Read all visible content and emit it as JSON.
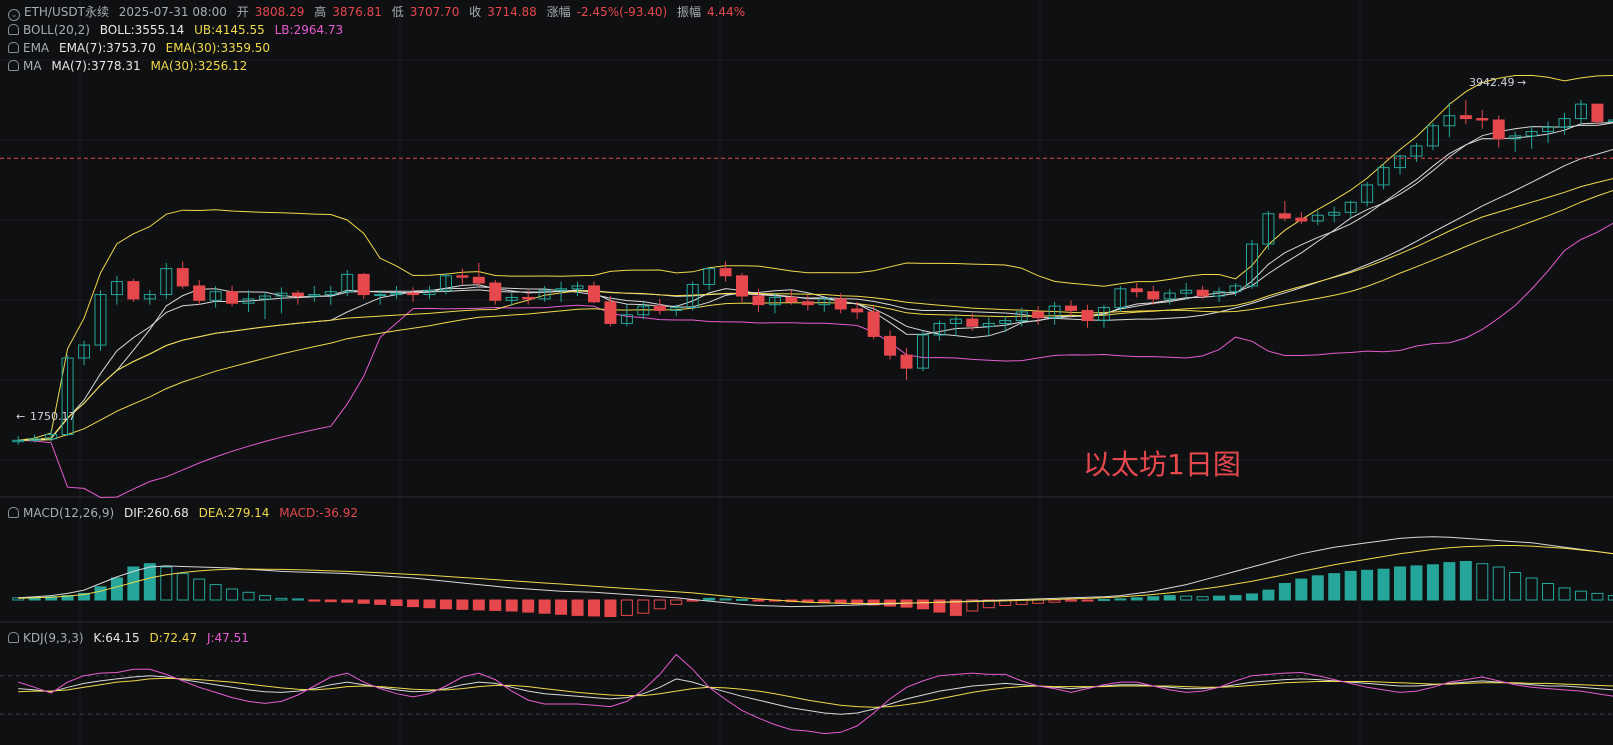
{
  "header": {
    "symbol": "ETH/USDT永续",
    "date": "2025-07-31 08:00",
    "open_label": "开",
    "open": "3808.29",
    "high_label": "高",
    "high": "3876.81",
    "low_label": "低",
    "low": "3707.70",
    "close_label": "收",
    "close": "3714.88",
    "change_label": "涨幅",
    "change": "-2.45%(-93.40)",
    "amp_label": "振幅",
    "amp": "4.44%"
  },
  "boll": {
    "name": "BOLL(20,2)",
    "boll": "BOLL:3555.14",
    "ub": "UB:4145.55",
    "lb": "LB:2964.73"
  },
  "ema": {
    "name": "EMA",
    "ema7": "EMA(7):3753.70",
    "ema30": "EMA(30):3359.50"
  },
  "ma": {
    "name": "MA",
    "ma7": "MA(7):3778.31",
    "ma30": "MA(30):3256.12"
  },
  "macd": {
    "name": "MACD(12,26,9)",
    "dif": "DIF:260.68",
    "dea": "DEA:279.14",
    "macd": "MACD:-36.92"
  },
  "kdj": {
    "name": "KDJ(9,3,3)",
    "k": "K:64.15",
    "d": "D:72.47",
    "j": "J:47.51"
  },
  "annotations": {
    "high_marker": "3942.49",
    "low_marker": "1750.17",
    "watermark": "以太坊1日图"
  },
  "colors": {
    "up": "#26a69a",
    "down": "#e5484d",
    "boll_mid": "#d9d9d9",
    "boll_band": "#f0d94b",
    "lower_band": "#e85bd1",
    "ema7": "#d9d9d9",
    "ema30": "#f0d94b",
    "ma7": "#d9d9d9",
    "ma30": "#f0d94b",
    "dif": "#d9d9d9",
    "dea": "#f0d94b",
    "k": "#d9d9d9",
    "d": "#f0d94b",
    "j": "#e85bd1"
  },
  "chart_data": {
    "type": "candlestick",
    "ylim": [
      1450,
      4500
    ],
    "current_price": 3714.88,
    "candles": [
      [
        1750,
        1790,
        1730,
        1760
      ],
      [
        1760,
        1800,
        1745,
        1770
      ],
      [
        1770,
        1830,
        1750,
        1800
      ],
      [
        1800,
        2350,
        1790,
        2330
      ],
      [
        2330,
        2450,
        2280,
        2420
      ],
      [
        2420,
        2800,
        2380,
        2770
      ],
      [
        2770,
        2900,
        2700,
        2860
      ],
      [
        2860,
        2880,
        2720,
        2740
      ],
      [
        2740,
        2800,
        2700,
        2770
      ],
      [
        2770,
        2990,
        2740,
        2950
      ],
      [
        2950,
        3000,
        2810,
        2830
      ],
      [
        2830,
        2870,
        2700,
        2730
      ],
      [
        2730,
        2830,
        2680,
        2790
      ],
      [
        2790,
        2830,
        2690,
        2710
      ],
      [
        2710,
        2800,
        2650,
        2740
      ],
      [
        2740,
        2790,
        2600,
        2760
      ],
      [
        2760,
        2820,
        2640,
        2780
      ],
      [
        2780,
        2800,
        2700,
        2760
      ],
      [
        2760,
        2830,
        2720,
        2770
      ],
      [
        2770,
        2830,
        2700,
        2790
      ],
      [
        2790,
        2940,
        2760,
        2910
      ],
      [
        2910,
        2920,
        2740,
        2770
      ],
      [
        2770,
        2800,
        2700,
        2770
      ],
      [
        2770,
        2830,
        2740,
        2780
      ],
      [
        2780,
        2820,
        2720,
        2770
      ],
      [
        2770,
        2830,
        2740,
        2800
      ],
      [
        2800,
        2920,
        2770,
        2900
      ],
      [
        2900,
        2950,
        2840,
        2890
      ],
      [
        2890,
        2990,
        2830,
        2850
      ],
      [
        2850,
        2870,
        2700,
        2730
      ],
      [
        2730,
        2780,
        2690,
        2750
      ],
      [
        2750,
        2800,
        2700,
        2740
      ],
      [
        2740,
        2830,
        2720,
        2800
      ],
      [
        2800,
        2860,
        2720,
        2810
      ],
      [
        2810,
        2860,
        2760,
        2830
      ],
      [
        2830,
        2860,
        2710,
        2720
      ],
      [
        2720,
        2760,
        2550,
        2570
      ],
      [
        2570,
        2700,
        2550,
        2630
      ],
      [
        2630,
        2720,
        2600,
        2690
      ],
      [
        2690,
        2740,
        2630,
        2660
      ],
      [
        2660,
        2700,
        2620,
        2680
      ],
      [
        2680,
        2860,
        2660,
        2840
      ],
      [
        2840,
        2960,
        2800,
        2950
      ],
      [
        2950,
        3000,
        2860,
        2900
      ],
      [
        2900,
        2920,
        2720,
        2760
      ],
      [
        2760,
        2810,
        2650,
        2700
      ],
      [
        2700,
        2780,
        2640,
        2750
      ],
      [
        2750,
        2800,
        2700,
        2720
      ],
      [
        2720,
        2770,
        2660,
        2700
      ],
      [
        2700,
        2760,
        2650,
        2740
      ],
      [
        2740,
        2780,
        2640,
        2670
      ],
      [
        2670,
        2720,
        2600,
        2650
      ],
      [
        2650,
        2690,
        2460,
        2480
      ],
      [
        2480,
        2520,
        2320,
        2350
      ],
      [
        2350,
        2400,
        2180,
        2260
      ],
      [
        2260,
        2520,
        2240,
        2490
      ],
      [
        2490,
        2590,
        2450,
        2570
      ],
      [
        2570,
        2620,
        2480,
        2600
      ],
      [
        2600,
        2640,
        2520,
        2550
      ],
      [
        2550,
        2610,
        2480,
        2570
      ],
      [
        2570,
        2620,
        2510,
        2590
      ],
      [
        2590,
        2680,
        2550,
        2650
      ],
      [
        2650,
        2690,
        2560,
        2610
      ],
      [
        2610,
        2720,
        2560,
        2690
      ],
      [
        2690,
        2730,
        2620,
        2660
      ],
      [
        2660,
        2700,
        2540,
        2590
      ],
      [
        2590,
        2700,
        2540,
        2680
      ],
      [
        2680,
        2830,
        2650,
        2810
      ],
      [
        2810,
        2850,
        2750,
        2790
      ],
      [
        2790,
        2830,
        2700,
        2740
      ],
      [
        2740,
        2810,
        2700,
        2780
      ],
      [
        2780,
        2850,
        2740,
        2800
      ],
      [
        2800,
        2830,
        2740,
        2760
      ],
      [
        2760,
        2820,
        2720,
        2790
      ],
      [
        2790,
        2850,
        2760,
        2830
      ],
      [
        2830,
        3150,
        2810,
        3120
      ],
      [
        3120,
        3350,
        3080,
        3330
      ],
      [
        3330,
        3420,
        3280,
        3300
      ],
      [
        3300,
        3340,
        3260,
        3280
      ],
      [
        3280,
        3350,
        3250,
        3320
      ],
      [
        3320,
        3380,
        3270,
        3340
      ],
      [
        3340,
        3420,
        3300,
        3410
      ],
      [
        3410,
        3550,
        3380,
        3530
      ],
      [
        3530,
        3680,
        3500,
        3650
      ],
      [
        3650,
        3740,
        3600,
        3730
      ],
      [
        3730,
        3820,
        3690,
        3800
      ],
      [
        3800,
        3960,
        3770,
        3940
      ],
      [
        3940,
        4100,
        3860,
        4010
      ],
      [
        4010,
        4120,
        3950,
        3990
      ],
      [
        3990,
        4050,
        3920,
        3980
      ],
      [
        3980,
        4010,
        3790,
        3850
      ],
      [
        3850,
        3900,
        3760,
        3870
      ],
      [
        3870,
        3940,
        3780,
        3900
      ],
      [
        3900,
        3970,
        3820,
        3930
      ],
      [
        3930,
        4030,
        3880,
        3990
      ],
      [
        3990,
        4120,
        3950,
        4090
      ],
      [
        4090,
        4060,
        3940,
        3970
      ],
      [
        3970,
        4010,
        3900,
        3980
      ],
      [
        3980,
        4000,
        3890,
        3990
      ],
      [
        3990,
        4030,
        3910,
        4000
      ],
      [
        3808,
        3876,
        3707,
        3714
      ]
    ],
    "macd_hist": [
      20,
      25,
      30,
      40,
      60,
      120,
      200,
      300,
      330,
      300,
      240,
      190,
      140,
      100,
      70,
      40,
      15,
      10,
      -10,
      -15,
      -20,
      -30,
      -40,
      -50,
      -60,
      -70,
      -80,
      -85,
      -90,
      -95,
      -100,
      -110,
      -120,
      -130,
      -140,
      -145,
      -150,
      -140,
      -120,
      -80,
      -40,
      -10,
      15,
      10,
      5,
      -5,
      -10,
      -15,
      -20,
      -25,
      -30,
      -35,
      -45,
      -55,
      -65,
      -80,
      -110,
      -140,
      -100,
      -70,
      -50,
      -40,
      -30,
      -20,
      -10,
      -5,
      5,
      10,
      20,
      30,
      40,
      35,
      30,
      35,
      40,
      55,
      90,
      150,
      190,
      220,
      240,
      260,
      270,
      280,
      300,
      310,
      320,
      340,
      350,
      330,
      300,
      250,
      200,
      150,
      110,
      80,
      60,
      40,
      20,
      -37
    ],
    "dif": [
      20,
      30,
      40,
      60,
      90,
      150,
      210,
      260,
      300,
      310,
      305,
      300,
      295,
      290,
      280,
      270,
      260,
      255,
      250,
      245,
      240,
      230,
      220,
      210,
      200,
      185,
      170,
      155,
      140,
      125,
      110,
      100,
      90,
      80,
      75,
      70,
      60,
      50,
      40,
      30,
      20,
      5,
      -10,
      -25,
      -40,
      -50,
      -55,
      -60,
      -58,
      -55,
      -50,
      -45,
      -40,
      -35,
      -30,
      -25,
      -20,
      -15,
      -10,
      -5,
      0,
      5,
      10,
      15,
      20,
      25,
      30,
      40,
      60,
      80,
      110,
      140,
      180,
      220,
      260,
      300,
      340,
      380,
      420,
      450,
      480,
      500,
      520,
      540,
      560,
      570,
      575,
      570,
      560,
      550,
      540,
      530,
      520,
      500,
      480,
      460,
      440,
      420,
      400,
      380,
      350,
      300,
      270,
      261
    ],
    "dea": [
      15,
      20,
      25,
      35,
      50,
      80,
      120,
      160,
      200,
      230,
      250,
      265,
      275,
      280,
      282,
      280,
      278,
      275,
      270,
      265,
      260,
      255,
      248,
      240,
      232,
      225,
      215,
      205,
      195,
      185,
      175,
      165,
      155,
      145,
      135,
      125,
      115,
      105,
      95,
      85,
      75,
      65,
      50,
      35,
      20,
      10,
      0,
      -10,
      -20,
      -25,
      -30,
      -32,
      -32,
      -30,
      -28,
      -25,
      -22,
      -18,
      -15,
      -12,
      -8,
      -4,
      0,
      5,
      10,
      15,
      20,
      28,
      38,
      50,
      65,
      82,
      100,
      120,
      145,
      170,
      200,
      230,
      260,
      290,
      320,
      345,
      370,
      395,
      420,
      440,
      460,
      475,
      485,
      490,
      495,
      495,
      490,
      480,
      470,
      455,
      440,
      420,
      400,
      380,
      360,
      340,
      320,
      300,
      290,
      279
    ],
    "k": [
      60,
      58,
      55,
      62,
      68,
      72,
      75,
      78,
      80,
      78,
      74,
      70,
      66,
      62,
      58,
      55,
      54,
      56,
      60,
      66,
      70,
      66,
      62,
      58,
      55,
      56,
      60,
      66,
      70,
      68,
      62,
      56,
      52,
      50,
      48,
      46,
      44,
      46,
      52,
      62,
      75,
      70,
      62,
      55,
      48,
      42,
      36,
      30,
      26,
      22,
      20,
      22,
      28,
      36,
      44,
      50,
      56,
      60,
      64,
      66,
      68,
      66,
      64,
      62,
      60,
      62,
      64,
      66,
      66,
      64,
      62,
      60,
      60,
      62,
      66,
      70,
      72,
      74,
      75,
      74,
      72,
      70,
      68,
      66,
      64,
      64,
      66,
      68,
      70,
      72,
      70,
      68,
      66,
      64,
      64,
      62,
      60,
      58,
      56,
      55,
      54,
      52,
      50,
      64
    ],
    "d": [
      55,
      56,
      56,
      58,
      62,
      66,
      70,
      72,
      75,
      76,
      75,
      74,
      72,
      70,
      67,
      64,
      61,
      59,
      58,
      60,
      63,
      64,
      63,
      61,
      59,
      58,
      58,
      60,
      63,
      65,
      65,
      63,
      60,
      57,
      54,
      52,
      50,
      49,
      49,
      52,
      56,
      60,
      62,
      61,
      59,
      56,
      52,
      47,
      42,
      38,
      34,
      32,
      31,
      32,
      35,
      39,
      44,
      49,
      54,
      58,
      61,
      63,
      64,
      63,
      63,
      63,
      63,
      64,
      64,
      64,
      64,
      63,
      62,
      62,
      63,
      65,
      67,
      69,
      70,
      71,
      71,
      71,
      71,
      70,
      69,
      68,
      67,
      67,
      68,
      69,
      69,
      69,
      68,
      68,
      67,
      66,
      65,
      64,
      63,
      62,
      61,
      60,
      59,
      58,
      72
    ],
    "j": [
      70,
      62,
      53,
      70,
      80,
      84,
      85,
      90,
      90,
      82,
      72,
      62,
      54,
      46,
      40,
      37,
      40,
      50,
      64,
      78,
      84,
      70,
      60,
      52,
      47,
      52,
      64,
      78,
      84,
      74,
      56,
      42,
      36,
      36,
      36,
      34,
      32,
      40,
      58,
      82,
      113,
      90,
      62,
      43,
      26,
      14,
      4,
      -4,
      -6,
      -10,
      -8,
      2,
      22,
      44,
      62,
      72,
      80,
      82,
      84,
      82,
      82,
      72,
      64,
      60,
      54,
      60,
      66,
      70,
      70,
      64,
      58,
      54,
      56,
      62,
      72,
      80,
      82,
      84,
      85,
      80,
      74,
      68,
      62,
      58,
      54,
      56,
      62,
      70,
      74,
      78,
      72,
      66,
      62,
      60,
      58,
      56,
      52,
      48,
      46,
      45,
      44,
      40,
      36,
      48
    ]
  }
}
